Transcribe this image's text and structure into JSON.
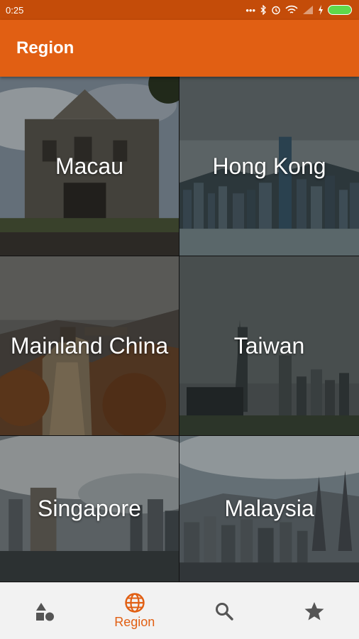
{
  "status_bar": {
    "time": "0:25"
  },
  "app_bar": {
    "title": "Region"
  },
  "regions": [
    {
      "label": "Macau"
    },
    {
      "label": "Hong Kong"
    },
    {
      "label": "Mainland China"
    },
    {
      "label": "Taiwan"
    },
    {
      "label": "Singapore"
    },
    {
      "label": "Malaysia"
    }
  ],
  "bottom_nav": {
    "items": [
      {
        "icon": "categories-icon",
        "label": ""
      },
      {
        "icon": "globe-icon",
        "label": "Region",
        "active": true
      },
      {
        "icon": "search-icon",
        "label": ""
      },
      {
        "icon": "star-icon",
        "label": ""
      }
    ]
  },
  "colors": {
    "status_bar": "#c44c09",
    "app_bar": "#e15f13",
    "accent": "#e15f13"
  }
}
